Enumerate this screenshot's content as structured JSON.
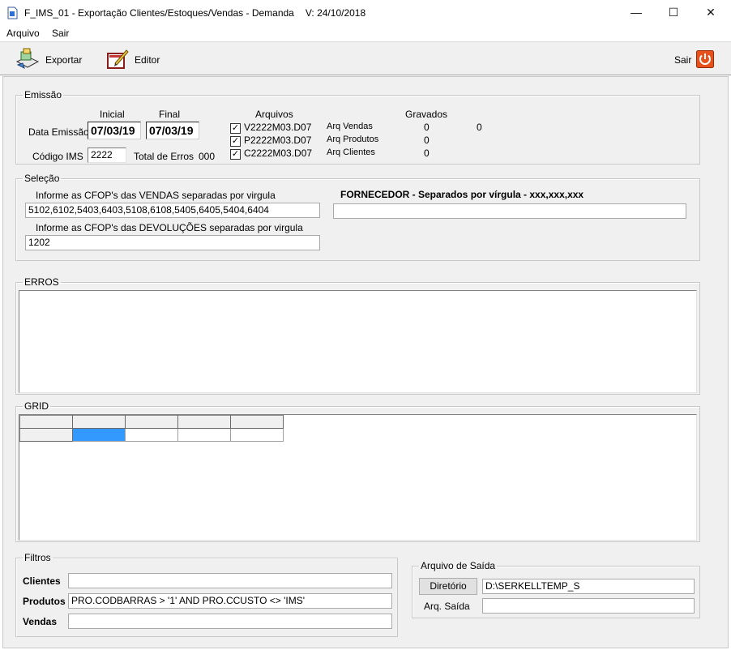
{
  "window": {
    "title": "F_IMS_01 - Exportação Clientes/Estoques/Vendas - Demanda",
    "version": "V: 24/10/2018",
    "minimize": "—",
    "maximize": "☐",
    "close": "✕"
  },
  "menu": {
    "items": [
      "Arquivo",
      "Sair"
    ]
  },
  "toolbar": {
    "exportar": "Exportar",
    "editor": "Editor",
    "sair": "Sair"
  },
  "emissao": {
    "legend": "Emissão",
    "inicial_label": "Inicial",
    "final_label": "Final",
    "data_emissao_label": "Data Emissão",
    "data_inicial": "07/03/19",
    "data_final": "07/03/19",
    "codigo_ims_label": "Código IMS",
    "codigo_ims": "2222",
    "total_erros_label": "Total de Erros",
    "total_erros": "000",
    "arquivos_header": "Arquivos",
    "gravados_header": "Gravados",
    "gravados_extra": "0",
    "arquivos": [
      {
        "checked": true,
        "file": "V2222M03.D07",
        "desc": "Arq Vendas",
        "gravados": "0"
      },
      {
        "checked": true,
        "file": "P2222M03.D07",
        "desc": "Arq Produtos",
        "gravados": "0"
      },
      {
        "checked": true,
        "file": "C2222M03.D07",
        "desc": "Arq Clientes",
        "gravados": "0"
      }
    ]
  },
  "selecao": {
    "legend": "Seleção",
    "vendas_label": "Informe as CFOP's das VENDAS separadas por virgula",
    "vendas_value": "5102,6102,5403,6403,5108,6108,5405,6405,5404,6404",
    "devolucoes_label": "Informe as CFOP's das DEVOLUÇÕES separadas por virgula",
    "devolucoes_value": "1202",
    "fornecedor_label": "FORNECEDOR - Separados por vírgula - xxx,xxx,xxx",
    "fornecedor_value": ""
  },
  "erros": {
    "legend": "ERROS"
  },
  "grid": {
    "legend": "GRID"
  },
  "filtros": {
    "legend": "Filtros",
    "clientes_label": "Clientes",
    "clientes_value": "",
    "produtos_label": "Produtos",
    "produtos_value": "PRO.CODBARRAS > '1' AND PRO.CCUSTO <> 'IMS'",
    "vendas_label": "Vendas",
    "vendas_value": ""
  },
  "saida": {
    "legend": "Arquivo de Saída",
    "diretorio_button": "Diretório",
    "diretorio_value": "D:\\SERKELLTEMP_S",
    "arq_saida_label": "Arq. Saída",
    "arq_saida_value": ""
  },
  "colors": {
    "grid_selected": "#3399ff",
    "sair_icon": "#e8501c"
  }
}
